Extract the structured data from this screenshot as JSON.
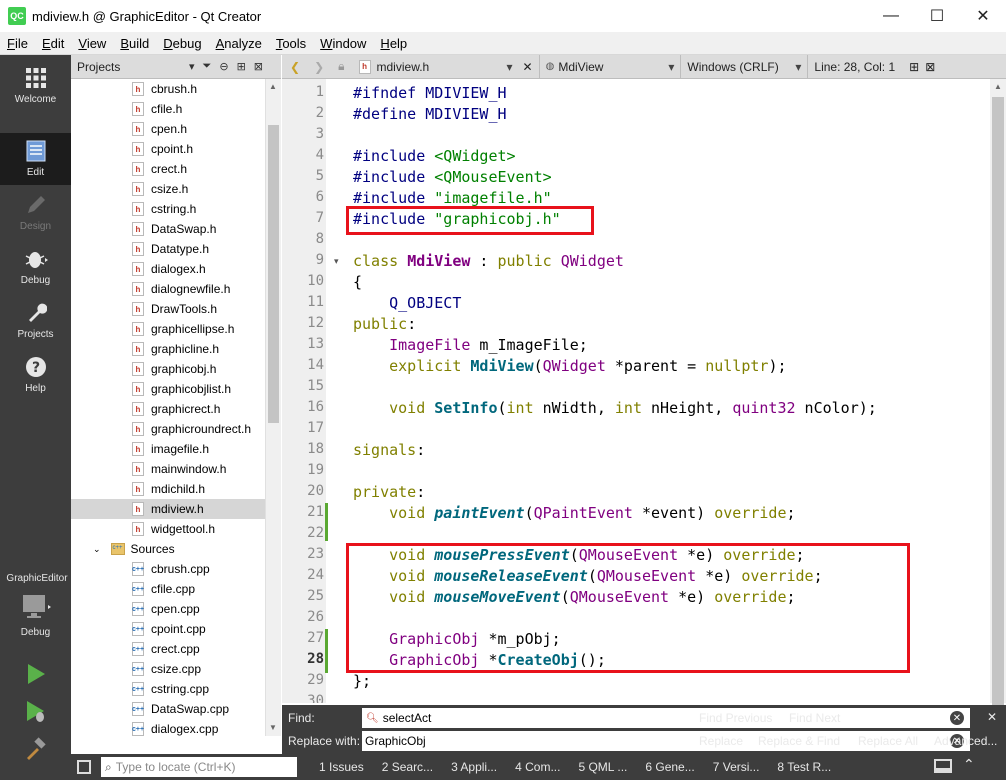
{
  "window": {
    "title": "mdiview.h @ GraphicEditor - Qt Creator",
    "logo": "QC",
    "minimize_glyph": "—",
    "maximize_glyph": "☐",
    "close_glyph": "✕"
  },
  "menu": [
    {
      "u": "F",
      "rest": "ile"
    },
    {
      "u": "E",
      "rest": "dit"
    },
    {
      "u": "V",
      "rest": "iew"
    },
    {
      "u": "B",
      "rest": "uild"
    },
    {
      "u": "D",
      "rest": "ebug"
    },
    {
      "u": "A",
      "rest": "nalyze"
    },
    {
      "u": "T",
      "rest": "ools"
    },
    {
      "u": "W",
      "rest": "indow"
    },
    {
      "u": "H",
      "rest": "elp"
    }
  ],
  "modes": {
    "welcome": "Welcome",
    "edit": "Edit",
    "design": "Design",
    "debug": "Debug",
    "projects": "Projects",
    "help": "Help",
    "kit_project": "GraphicEditor",
    "kit_mode": "Debug"
  },
  "project_pane": {
    "title": "Projects",
    "headers": [
      "cbrush.h",
      "cfile.h",
      "cpen.h",
      "cpoint.h",
      "crect.h",
      "csize.h",
      "cstring.h",
      "DataSwap.h",
      "Datatype.h",
      "dialogex.h",
      "dialognewfile.h",
      "DrawTools.h",
      "graphicellipse.h",
      "graphicline.h",
      "graphicobj.h",
      "graphicobjlist.h",
      "graphicrect.h",
      "graphicroundrect.h",
      "imagefile.h",
      "mainwindow.h",
      "mdichild.h",
      "mdiview.h",
      "widgettool.h"
    ],
    "sources_folder": "Sources",
    "sources": [
      "cbrush.cpp",
      "cfile.cpp",
      "cpen.cpp",
      "cpoint.cpp",
      "crect.cpp",
      "csize.cpp",
      "cstring.cpp",
      "DataSwap.cpp",
      "dialogex.cpp"
    ],
    "selected": "mdiview.h"
  },
  "editor_toolbar": {
    "file": "mdiview.h",
    "symbol": "MdiView",
    "line_endings": "Windows (CRLF)",
    "position": "Line: 28, Col: 1"
  },
  "editor": {
    "line_numbers": [
      "1",
      "2",
      "3",
      "4",
      "5",
      "6",
      "7",
      "8",
      "9",
      "10",
      "11",
      "12",
      "13",
      "14",
      "15",
      "16",
      "17",
      "18",
      "19",
      "20",
      "21",
      "22",
      "23",
      "24",
      "25",
      "26",
      "27",
      "28",
      "29",
      "30"
    ],
    "current_line": "28"
  },
  "find": {
    "find_label": "Find:",
    "find_value": "selectAct",
    "replace_label": "Replace with:",
    "replace_value": "GraphicObj",
    "find_previous": "Find Previous",
    "find_next": "Find Next",
    "replace": "Replace",
    "replace_find": "Replace & Find",
    "replace_all": "Replace All",
    "advanced": "Advanced..."
  },
  "status": {
    "locate_placeholder": "Type to locate (Ctrl+K)",
    "panes": [
      "1  Issues",
      "2  Searc...",
      "3  Appli...",
      "4  Com...",
      "5  QML ...",
      "6  Gene...",
      "7  Versi...",
      "8  Test R..."
    ]
  }
}
